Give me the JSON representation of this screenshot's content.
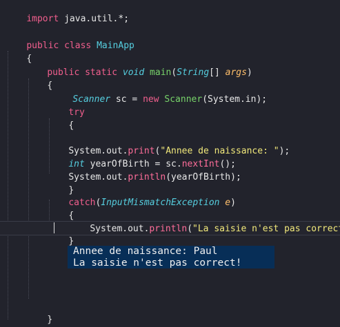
{
  "editor": {
    "lines": {
      "l1": {
        "kw": "import",
        "rest": " java.util.*;"
      },
      "l3": {
        "kw1": "public",
        "kw2": "class",
        "cls": "MainApp"
      },
      "l4": {
        "brace": "{"
      },
      "l5": {
        "kw1": "public",
        "kw2": "static",
        "type": "void",
        "fn": "main",
        "open": "(",
        "ptype": "String",
        "arr": "[] ",
        "param": "args",
        "close": ")"
      },
      "l6": {
        "brace": "{"
      },
      "l7": {
        "type": "Scanner",
        "var": " sc = ",
        "kw": "new",
        "ctor": "Scanner",
        "args": "(System.in);"
      },
      "l8": {
        "kw": "try"
      },
      "l9": {
        "brace": "{"
      },
      "l11": {
        "prefix": "System.out.",
        "method": "print",
        "open": "(",
        "str": "\"Annee de naissance: \"",
        "close": ");"
      },
      "l12": {
        "type": "int",
        "var": " yearOfBirth = sc.",
        "method": "nextInt",
        "close": "();"
      },
      "l13": {
        "prefix": "System.out.",
        "method": "println",
        "args": "(yearOfBirth);"
      },
      "l14": {
        "brace": "}"
      },
      "l15": {
        "kw": "catch",
        "open": "(",
        "type": "InputMismatchException",
        "param": "e",
        "close": ")"
      },
      "l16": {
        "brace": "{"
      },
      "l17": {
        "prefix": "System.out.",
        "method": "println",
        "open": "(",
        "str": "\"La saisie n'est pas correct!\"",
        "close": ");"
      },
      "l18": {
        "brace": "}"
      },
      "l22": {
        "brace": "}"
      },
      "l23": {
        "brace": "}"
      }
    }
  },
  "console": {
    "line1": "Annee de naissance: Paul",
    "line2": "La saisie n'est pas correct!"
  },
  "colors": {
    "background": "#22232c",
    "keyword": "#f25f8e",
    "type": "#56cfe0",
    "string": "#f2e97b",
    "function": "#ffbf6b",
    "console_bg": "#072e57"
  }
}
